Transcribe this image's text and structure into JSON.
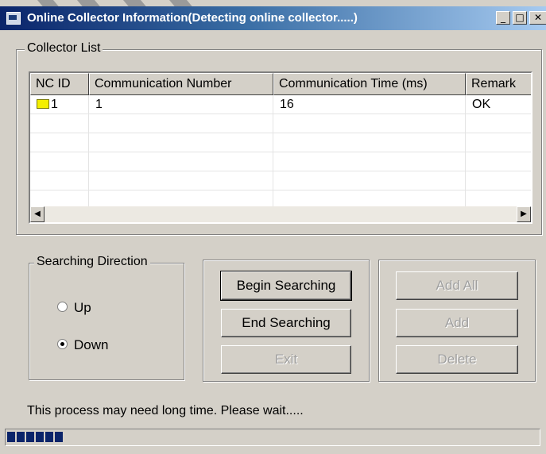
{
  "window": {
    "title": "Online Collector Information(Detecting online collector.....)",
    "minimize": "_",
    "maximize": "□"
  },
  "collector_list": {
    "label": "Collector List",
    "columns": [
      "NC ID",
      "Communication Number",
      "Communication Time (ms)",
      "Remark"
    ],
    "rows": [
      {
        "nc_id": "1",
        "comm_number": "1",
        "comm_time": "16",
        "remark": "OK"
      }
    ]
  },
  "search_direction": {
    "label": "Searching Direction",
    "options": [
      {
        "label": "Up",
        "selected": false
      },
      {
        "label": "Down",
        "selected": true
      }
    ]
  },
  "buttons": {
    "begin": "Begin Searching",
    "end": "End Searching",
    "exit": "Exit",
    "add_all": "Add All",
    "add": "Add",
    "delete": "Delete"
  },
  "status": {
    "message": "This process may need long time. Please wait.....",
    "progress_blocks": 6
  },
  "colors": {
    "title_start": "#0a246a",
    "title_end": "#a6caf0",
    "face": "#d4d0c8",
    "progress": "#0a246a"
  }
}
